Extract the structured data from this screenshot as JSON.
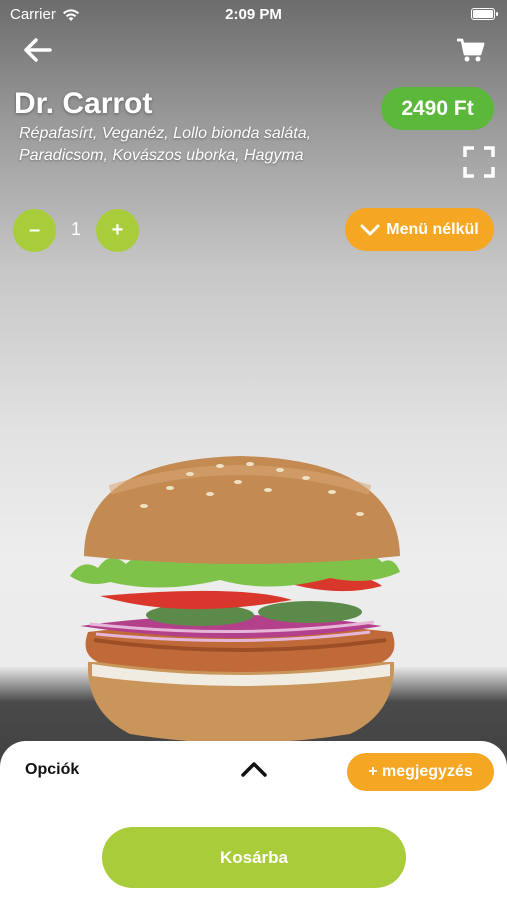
{
  "status_bar": {
    "carrier": "Carrier",
    "time": "2:09 PM"
  },
  "nav": {
    "back_icon": "arrow-left-icon",
    "cart_icon": "shopping-cart-icon"
  },
  "product": {
    "name": "Dr. Carrot",
    "ingredients": "Répafasírt, Veganéz, Lollo bionda saláta, Paradicsom, Kovászos uborka, Hagyma",
    "price": "2490 Ft",
    "fullscreen_icon": "fullscreen-icon"
  },
  "quantity": {
    "minus_label": "–",
    "value": "1",
    "plus_label": "+"
  },
  "menu_button": {
    "label": "Menü nélkül",
    "icon": "chevron-down-icon"
  },
  "sheet": {
    "options_label": "Opciók",
    "expand_icon": "chevron-up-icon",
    "note_button": "+ megjegyzés",
    "add_to_cart": "Kosárba"
  },
  "colors": {
    "price_green": "#5cb83a",
    "action_lime": "#a8cc3a",
    "accent_orange": "#f5a623"
  }
}
